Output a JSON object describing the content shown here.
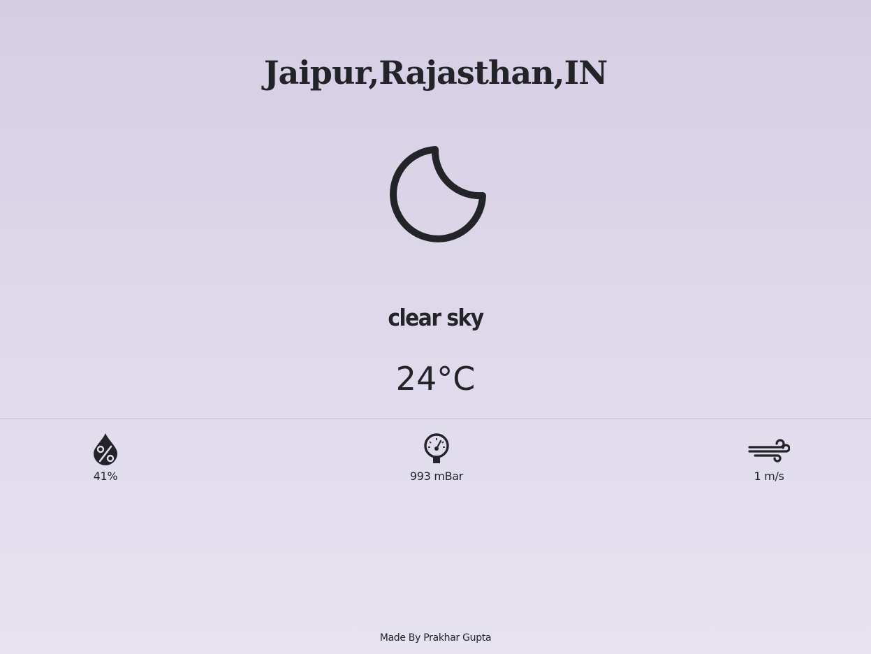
{
  "location": "Jaipur,Rajasthan,IN",
  "weather": {
    "icon": "moon-icon",
    "description": "clear sky",
    "temperature": "24°C"
  },
  "stats": {
    "humidity": {
      "icon": "humidity-drop-icon",
      "value": "41%"
    },
    "pressure": {
      "icon": "pressure-gauge-icon",
      "value": "993 mBar"
    },
    "wind": {
      "icon": "wind-icon",
      "value": "1 m/s"
    }
  },
  "footer": "Made By Prakhar Gupta",
  "colors": {
    "text": "#222428",
    "background_top": "#d6cee4",
    "background_bottom": "#e6e2ef"
  }
}
